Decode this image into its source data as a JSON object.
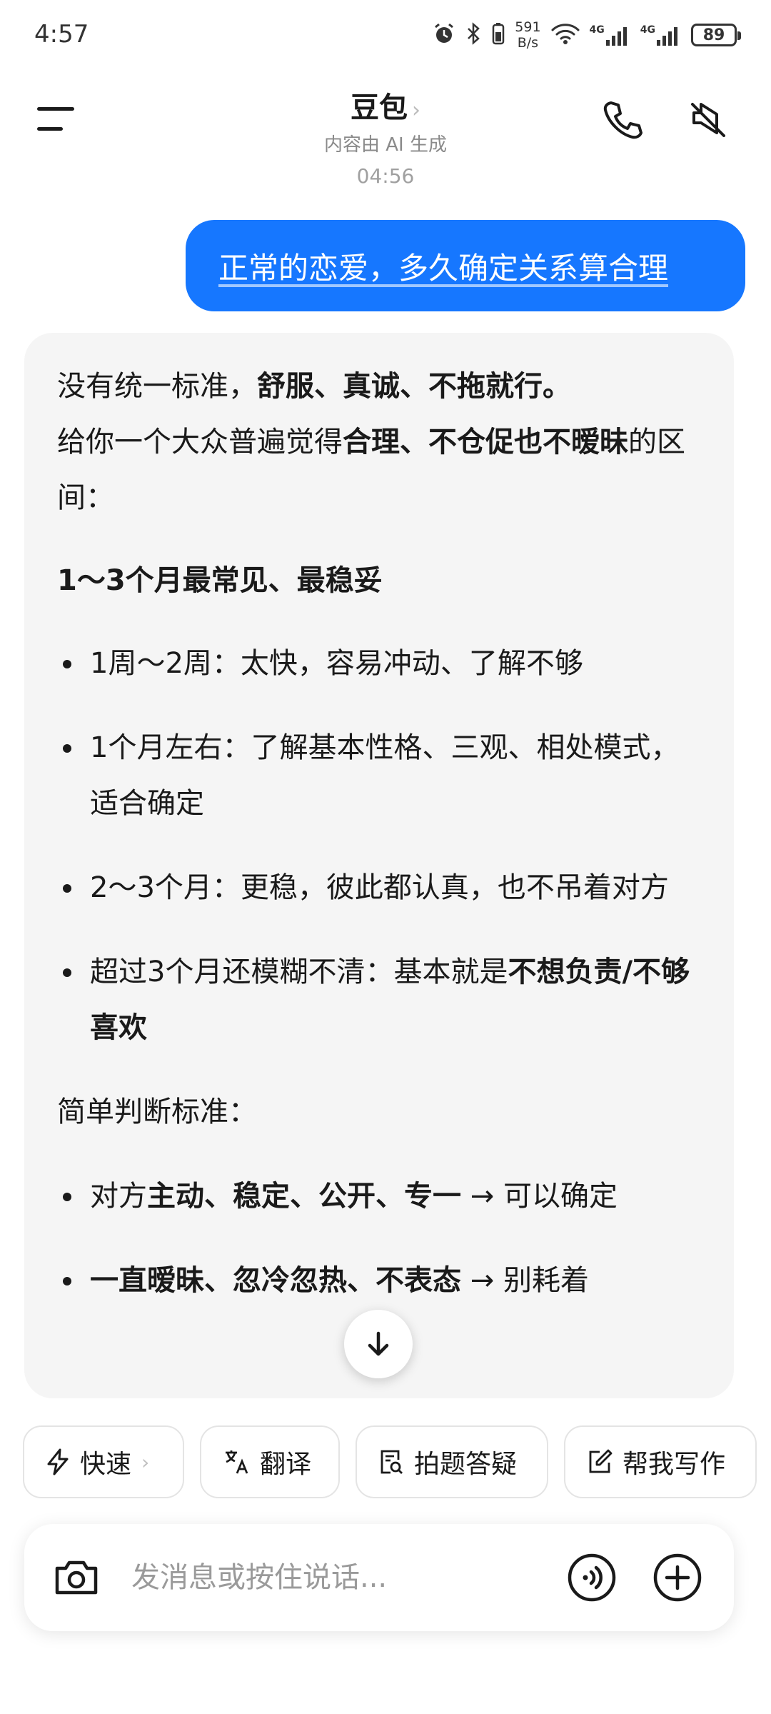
{
  "status": {
    "time": "4:57",
    "net_speed_value": "591",
    "net_speed_unit": "B/s",
    "signal1": "4G",
    "signal2": "4G",
    "battery": "89"
  },
  "header": {
    "title": "豆包",
    "subtitle": "内容由 AI 生成"
  },
  "chat": {
    "timestamp": "04:56",
    "user_message": "正常的恋爱，多久确定关系算合理",
    "ai": {
      "p1_a": "没有统一标准，",
      "p1_b": "舒服、真诚、不拖就行。",
      "p2_a": "给你一个大众普遍觉得",
      "p2_b": "合理、不仓促也不暧昧",
      "p2_c": "的区间：",
      "heading": "1～3个月最常见、最稳妥",
      "bullets": [
        "1周～2周：太快，容易冲动、了解不够",
        "1个月左右：了解基本性格、三观、相处模式，适合确定",
        "2～3个月：更稳，彼此都认真，也不吊着对方"
      ],
      "b4_a": "超过3个月还模糊不清：基本就是",
      "b4_b": "不想负责/不够喜欢",
      "sub_heading": "简单判断标准：",
      "b5_a": "对方",
      "b5_b": "主动、稳定、公开、专一",
      "b5_c": " → 可以确定",
      "b6_a": "一直暧昧、忽冷忽热、不表态",
      "b6_b": " → 别耗着"
    }
  },
  "chips": {
    "fast": "快速",
    "translate": "翻译",
    "photo_qa": "拍题答疑",
    "write": "帮我写作"
  },
  "input": {
    "placeholder": "发消息或按住说话..."
  }
}
